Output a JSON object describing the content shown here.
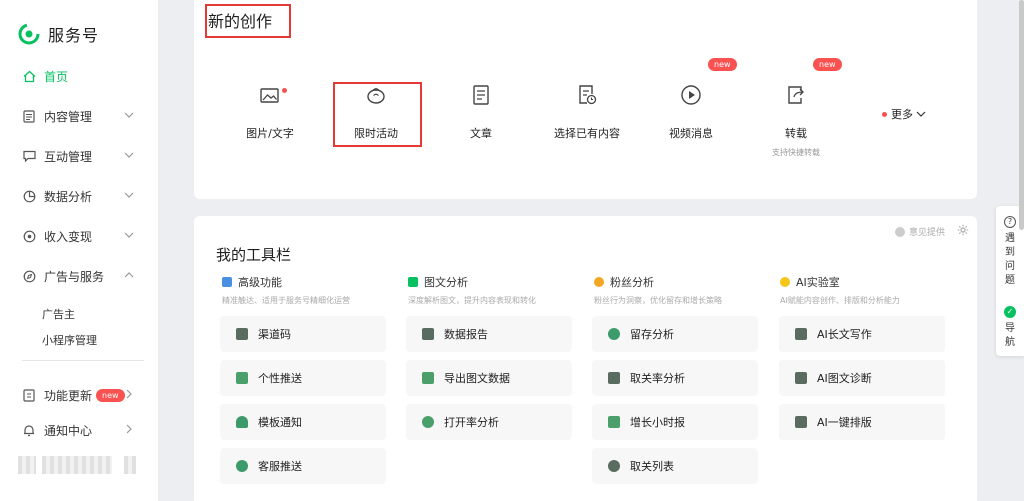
{
  "brand": {
    "name": "服务号",
    "color": "#07c160"
  },
  "sidebar": {
    "items": [
      {
        "label": "首页",
        "icon": "home-icon",
        "active": true
      },
      {
        "label": "内容管理",
        "icon": "document-icon"
      },
      {
        "label": "互动管理",
        "icon": "chat-icon"
      },
      {
        "label": "数据分析",
        "icon": "pie-chart-icon"
      },
      {
        "label": "收入变现",
        "icon": "money-icon"
      },
      {
        "label": "广告与服务",
        "icon": "compass-icon",
        "expanded": true
      }
    ],
    "sub_items": [
      "广告主",
      "小程序管理"
    ],
    "bottom": [
      {
        "label": "功能更新",
        "badge": "new",
        "icon": "update-icon"
      },
      {
        "label": "通知中心",
        "icon": "bell-icon"
      }
    ]
  },
  "creation": {
    "title": "新的创作",
    "items": [
      {
        "label": "图片/文字",
        "icon": "image-text-icon",
        "dot": true
      },
      {
        "label": "限时活动",
        "icon": "timed-activity-icon"
      },
      {
        "label": "文章",
        "icon": "article-icon"
      },
      {
        "label": "选择已有内容",
        "icon": "existing-content-icon"
      },
      {
        "label": "视频消息",
        "icon": "video-play-icon",
        "badge": "new"
      },
      {
        "label": "转载",
        "icon": "repost-icon",
        "badge": "new",
        "sub": "支持快捷转载"
      }
    ],
    "more": "更多"
  },
  "toolbar": {
    "title": "我的工具栏",
    "feedback": "意见提供",
    "columns": [
      {
        "title": "高级功能",
        "desc": "精准触达、适用于服务号精细化运营",
        "icon_color": "#4a90e2",
        "tools": [
          "渠道码",
          "个性推送",
          "模板通知",
          "客服推送"
        ]
      },
      {
        "title": "图文分析",
        "desc": "深度解析图文，提升内容表现和转化",
        "icon_color": "#07c160",
        "tools": [
          "数据报告",
          "导出图文数据",
          "打开率分析"
        ]
      },
      {
        "title": "粉丝分析",
        "desc": "粉丝行为洞察，优化留存和增长策略",
        "icon_color": "#f5a623",
        "tools": [
          "留存分析",
          "取关率分析",
          "增长小时报",
          "取关列表"
        ]
      },
      {
        "title": "AI实验室",
        "desc": "AI赋能内容创作、排版和分析能力",
        "icon_color": "#f5c518",
        "tools": [
          "AI长文写作",
          "AI图文诊断",
          "AI一键排版"
        ]
      }
    ]
  },
  "help": {
    "problem": "遇到问题",
    "guide": "导航"
  }
}
